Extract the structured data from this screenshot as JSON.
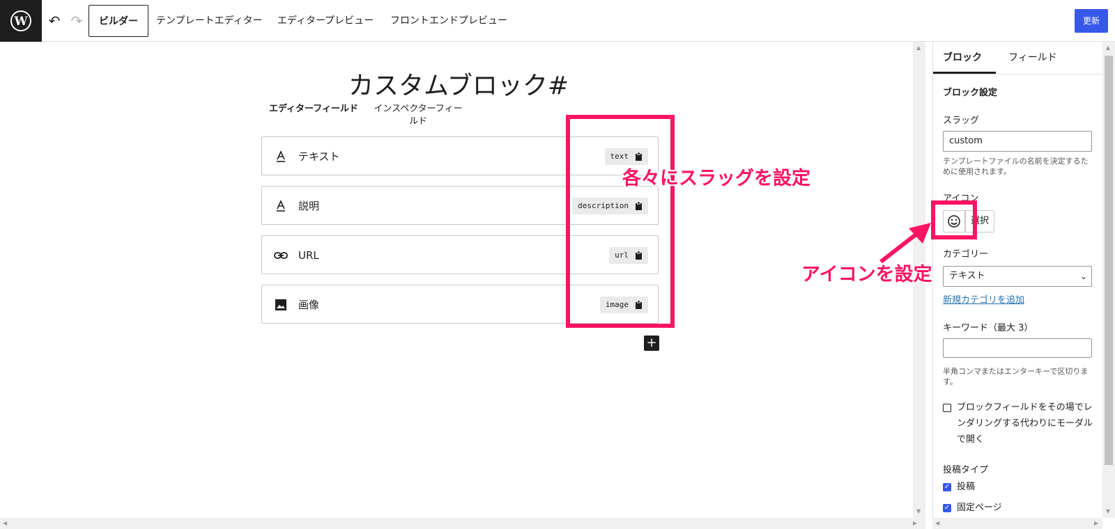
{
  "toolbar": {
    "tabs": [
      "ビルダー",
      "テンプレートエディター",
      "エディタープレビュー",
      "フロントエンドプレビュー"
    ],
    "update_label": "更新"
  },
  "canvas": {
    "title": "カスタムブロック#",
    "inner_tabs": [
      "エディターフィールド",
      "インスペクターフィールド"
    ],
    "fields": [
      {
        "icon": "text-icon",
        "label": "テキスト",
        "slug": "text"
      },
      {
        "icon": "text-icon",
        "label": "説明",
        "slug": "description"
      },
      {
        "icon": "link-icon",
        "label": "URL",
        "slug": "url"
      },
      {
        "icon": "image-icon",
        "label": "画像",
        "slug": "image"
      }
    ],
    "add_label": "+"
  },
  "sidebar": {
    "tabs": [
      "ブロック",
      "フィールド"
    ],
    "heading": "ブロック設定",
    "slug_label": "スラッグ",
    "slug_value": "custom",
    "slug_help": "テンプレートファイルの名前を決定するために使用されます。",
    "icon_label": "アイコン",
    "icon_select_label": "選択",
    "category_label": "カテゴリー",
    "category_value": "テキスト",
    "add_category_link": "新規カテゴリを追加",
    "keyword_label": "キーワード（最大 3）",
    "keyword_value": "",
    "keyword_help": "半角コンマまたはエンターキーで区切ります。",
    "modal_checkbox_label": "ブロックフィールドをその場でレンダリングする代わりにモーダルで開く",
    "post_type_label": "投稿タイプ",
    "post_types": [
      {
        "label": "投稿",
        "checked": true
      },
      {
        "label": "固定ページ",
        "checked": true
      }
    ]
  },
  "annotations": {
    "slug_note": "各々にスラッグを設定",
    "icon_note": "アイコンを設定",
    "color": "#ff1461"
  },
  "colors": {
    "accent": "#3858e9",
    "link": "#2271b1",
    "annotation": "#ff1461"
  }
}
